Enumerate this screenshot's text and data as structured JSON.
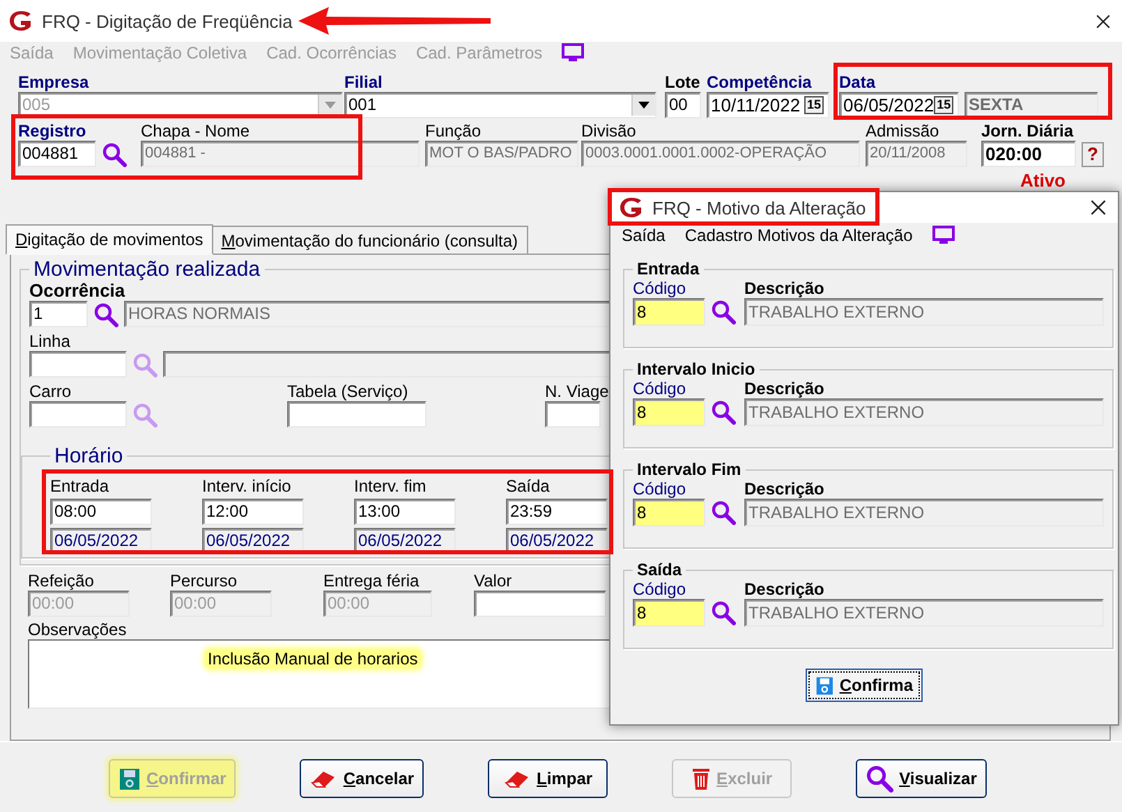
{
  "window": {
    "title": "FRQ - Digitação de Freqüência"
  },
  "menu": [
    {
      "label": "Saída",
      "disabled": true
    },
    {
      "label": "Movimentação Coletiva",
      "disabled": true
    },
    {
      "label": "Cad. Ocorrências",
      "disabled": true
    },
    {
      "label": "Cad. Parâmetros",
      "disabled": true
    }
  ],
  "header": {
    "row_1": [
      {
        "kind": "combo",
        "label": "Empresa",
        "required": true,
        "bold": true,
        "value": "005",
        "disabled": true
      },
      {
        "kind": "combo",
        "label": "Filial",
        "required": true,
        "bold": true,
        "value": "001",
        "disabled": false
      },
      {
        "kind": "input",
        "label": "Lote",
        "required": false,
        "bold": true,
        "value": "00"
      },
      {
        "kind": "date",
        "label": "Competência",
        "required": true,
        "bold": true,
        "value": "10/11/2022",
        "button": "15"
      },
      {
        "kind": "date",
        "label": "Data",
        "required": true,
        "bold": true,
        "value": "06/05/2022",
        "button": "15"
      },
      {
        "kind": "readonly",
        "value": "SEXTA",
        "value_bold": true
      }
    ],
    "row_2": [
      {
        "kind": "search",
        "label": "Registro",
        "required": true,
        "bold": true,
        "value": "004881"
      },
      {
        "kind": "readonly",
        "label": "Chapa - Nome",
        "required": false,
        "bold": false,
        "value": "004881 -"
      },
      {
        "kind": "readonly",
        "label": "Função",
        "required": false,
        "bold": false,
        "value": "MOT O BAS/PADRO"
      },
      {
        "kind": "readonly",
        "label": "Divisão",
        "required": false,
        "bold": false,
        "value": "0003.0001.0001.0002-OPERAÇÃO"
      },
      {
        "kind": "readonly",
        "label": "Admissão",
        "required": false,
        "bold": false,
        "value": "20/11/2008"
      },
      {
        "kind": "help",
        "label": "Jorn. Diária",
        "required": false,
        "bold": true,
        "value": "020:00",
        "button": "?"
      }
    ],
    "status": "Ativo"
  },
  "tabs": [
    {
      "label": "Digitação de movimentos",
      "selected": true
    },
    {
      "label": "Movimentação do funcionário (consulta)",
      "selected": false
    }
  ],
  "movimentacao": {
    "title": "Movimentação realizada",
    "ocorrencia": {
      "label": "Ocorrência",
      "value": "1",
      "description": "HORAS NORMAIS",
      "search_enabled": true
    },
    "linha": {
      "label": "Linha",
      "search_enabled": false
    },
    "carro": {
      "label": "Carro",
      "search_enabled": false
    },
    "tabela": {
      "label": "Tabela (Serviço)"
    },
    "viagem": {
      "label": "N. Viage"
    }
  },
  "horario": {
    "title": "Horário",
    "columns": [
      {
        "label": "Entrada",
        "time": "08:00",
        "date": "06/05/2022"
      },
      {
        "label": "Interv. início",
        "time": "12:00",
        "date": "06/05/2022"
      },
      {
        "label": "Interv. fim",
        "time": "13:00",
        "date": "06/05/2022"
      },
      {
        "label": "Saída",
        "time": "23:59",
        "date": "06/05/2022"
      }
    ]
  },
  "extras": [
    {
      "label": "Refeição",
      "value": "00:00",
      "disabled": true
    },
    {
      "label": "Percurso",
      "value": "00:00",
      "disabled": true
    },
    {
      "label": "Entrega féria",
      "value": "00:00",
      "disabled": true
    },
    {
      "label": "Valor",
      "disabled": false
    }
  ],
  "observacoes": {
    "label": "Observações",
    "tooltip": "Inclusão Manual de horarios"
  },
  "buttons": [
    {
      "kind": "save",
      "label": "Confirmar",
      "disabled": true,
      "highlighted": true
    },
    {
      "kind": "eraser",
      "label": "Cancelar",
      "disabled": false,
      "highlighted": false
    },
    {
      "kind": "eraser",
      "label": "Limpar",
      "disabled": false,
      "highlighted": false
    },
    {
      "kind": "trash",
      "label": "Excluir",
      "disabled": true,
      "highlighted": false
    },
    {
      "kind": "search",
      "label": "Visualizar",
      "disabled": false,
      "highlighted": false
    }
  ],
  "dialog": {
    "title": "FRQ - Motivo da Alteração",
    "menu": [
      {
        "label": "Saída",
        "disabled": false
      },
      {
        "label": "Cadastro Motivos da Alteração",
        "disabled": false
      }
    ],
    "groups": [
      {
        "title": "Entrada",
        "code_label": "Código",
        "code": "8",
        "description_label": "Descrição",
        "description": "TRABALHO EXTERNO"
      },
      {
        "title": "Intervalo Inicio",
        "code_label": "Código",
        "code": "8",
        "description_label": "Descrição",
        "description": "TRABALHO EXTERNO"
      },
      {
        "title": "Intervalo Fim",
        "code_label": "Código",
        "code": "8",
        "description_label": "Descrição",
        "description": "TRABALHO EXTERNO"
      },
      {
        "title": "Saída",
        "code_label": "Código",
        "code": "8",
        "description_label": "Descrição",
        "description": "TRABALHO EXTERNO"
      }
    ],
    "confirm": "Confirma"
  }
}
